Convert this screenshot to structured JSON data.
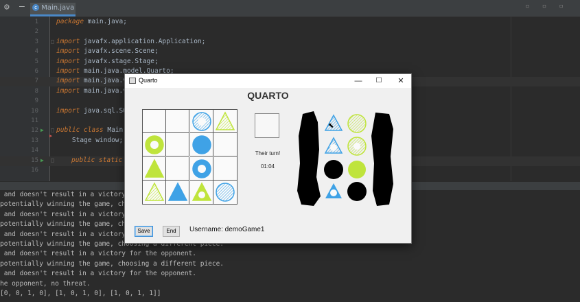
{
  "ide": {
    "tab_label": "Main.java",
    "line_numbers": [
      "1",
      "2",
      "3",
      "4",
      "5",
      "6",
      "7",
      "8",
      "9",
      "10",
      "11",
      "12",
      "13",
      "14",
      "15",
      "16"
    ],
    "code_lines": [
      {
        "kw": "package",
        "text": " main.java;"
      },
      {
        "kw": "",
        "text": ""
      },
      {
        "kw": "import",
        "text": " javafx.application.Application;"
      },
      {
        "kw": "import",
        "text": " javafx.scene.Scene;"
      },
      {
        "kw": "import",
        "text": " javafx.stage.Stage;"
      },
      {
        "kw": "import",
        "text": " main.java.model.Quarto;"
      },
      {
        "kw": "import",
        "text": " main.java.v"
      },
      {
        "kw": "import",
        "text": " main.java.v"
      },
      {
        "kw": "",
        "text": ""
      },
      {
        "kw": "import",
        "text": " java.sql.SQ"
      },
      {
        "kw": "",
        "text": ""
      },
      {
        "kw": "public class",
        "text": " Main"
      },
      {
        "kw": "",
        "text": "    Stage window;"
      },
      {
        "kw": "",
        "text": ""
      },
      {
        "kw": "public static",
        "text": ""
      },
      {
        "kw": "",
        "text": ""
      }
    ],
    "console_lines": [
      " and doesn't result in a victory",
      "potentially winning the game, choo",
      " and doesn't result in a victory fo",
      "potentially winning the game, choo",
      " and doesn't result in a victory fo",
      "potentially winning the game, choosing a different piece.",
      " and doesn't result in a victory for the opponent.",
      "potentially winning the game, choosing a different piece.",
      " and doesn't result in a victory for the opponent.",
      "he opponent, no threat.",
      "[0, 0, 1, 0], [1, 0, 1, 0], [1, 0, 1, 1]]"
    ]
  },
  "window": {
    "title": "Quarto",
    "heading": "QUARTO",
    "turn_text": "Their turn!",
    "timer": "01:04",
    "save_label": "Save",
    "end_label": "End",
    "username": "Username: demoGame1"
  },
  "colors": {
    "blue": "#3fa2e6",
    "green": "#bfe43c"
  },
  "board": [
    [
      null,
      null,
      {
        "shape": "circle",
        "color": "blue",
        "style": "hatched-hollow"
      },
      {
        "shape": "triangle",
        "color": "green",
        "style": "hatched"
      }
    ],
    [
      {
        "shape": "circle",
        "color": "green",
        "style": "hollow"
      },
      null,
      {
        "shape": "circle",
        "color": "blue",
        "style": "solid"
      },
      null
    ],
    [
      {
        "shape": "triangle",
        "color": "green",
        "style": "solid"
      },
      null,
      {
        "shape": "circle",
        "color": "blue",
        "style": "hollow"
      },
      null
    ],
    [
      {
        "shape": "triangle",
        "color": "green",
        "style": "hatched"
      },
      {
        "shape": "triangle",
        "color": "blue",
        "style": "solid"
      },
      {
        "shape": "triangle",
        "color": "green",
        "style": "hollow"
      },
      {
        "shape": "circle",
        "color": "blue",
        "style": "hatched"
      }
    ]
  ],
  "available_pieces": [
    {
      "shape": "triangle",
      "color": "blue",
      "style": "hatched"
    },
    {
      "shape": "circle",
      "color": "green",
      "style": "hatched"
    },
    {
      "shape": "triangle",
      "color": "blue",
      "style": "hatched-hollow"
    },
    {
      "shape": "circle",
      "color": "green",
      "style": "hatched-hollow"
    },
    {
      "shape": "circle",
      "color": "black",
      "style": "solid"
    },
    {
      "shape": "circle",
      "color": "green",
      "style": "solid"
    },
    {
      "shape": "triangle",
      "color": "blue",
      "style": "hollow"
    },
    {
      "shape": "circle",
      "color": "black",
      "style": "solid"
    }
  ]
}
